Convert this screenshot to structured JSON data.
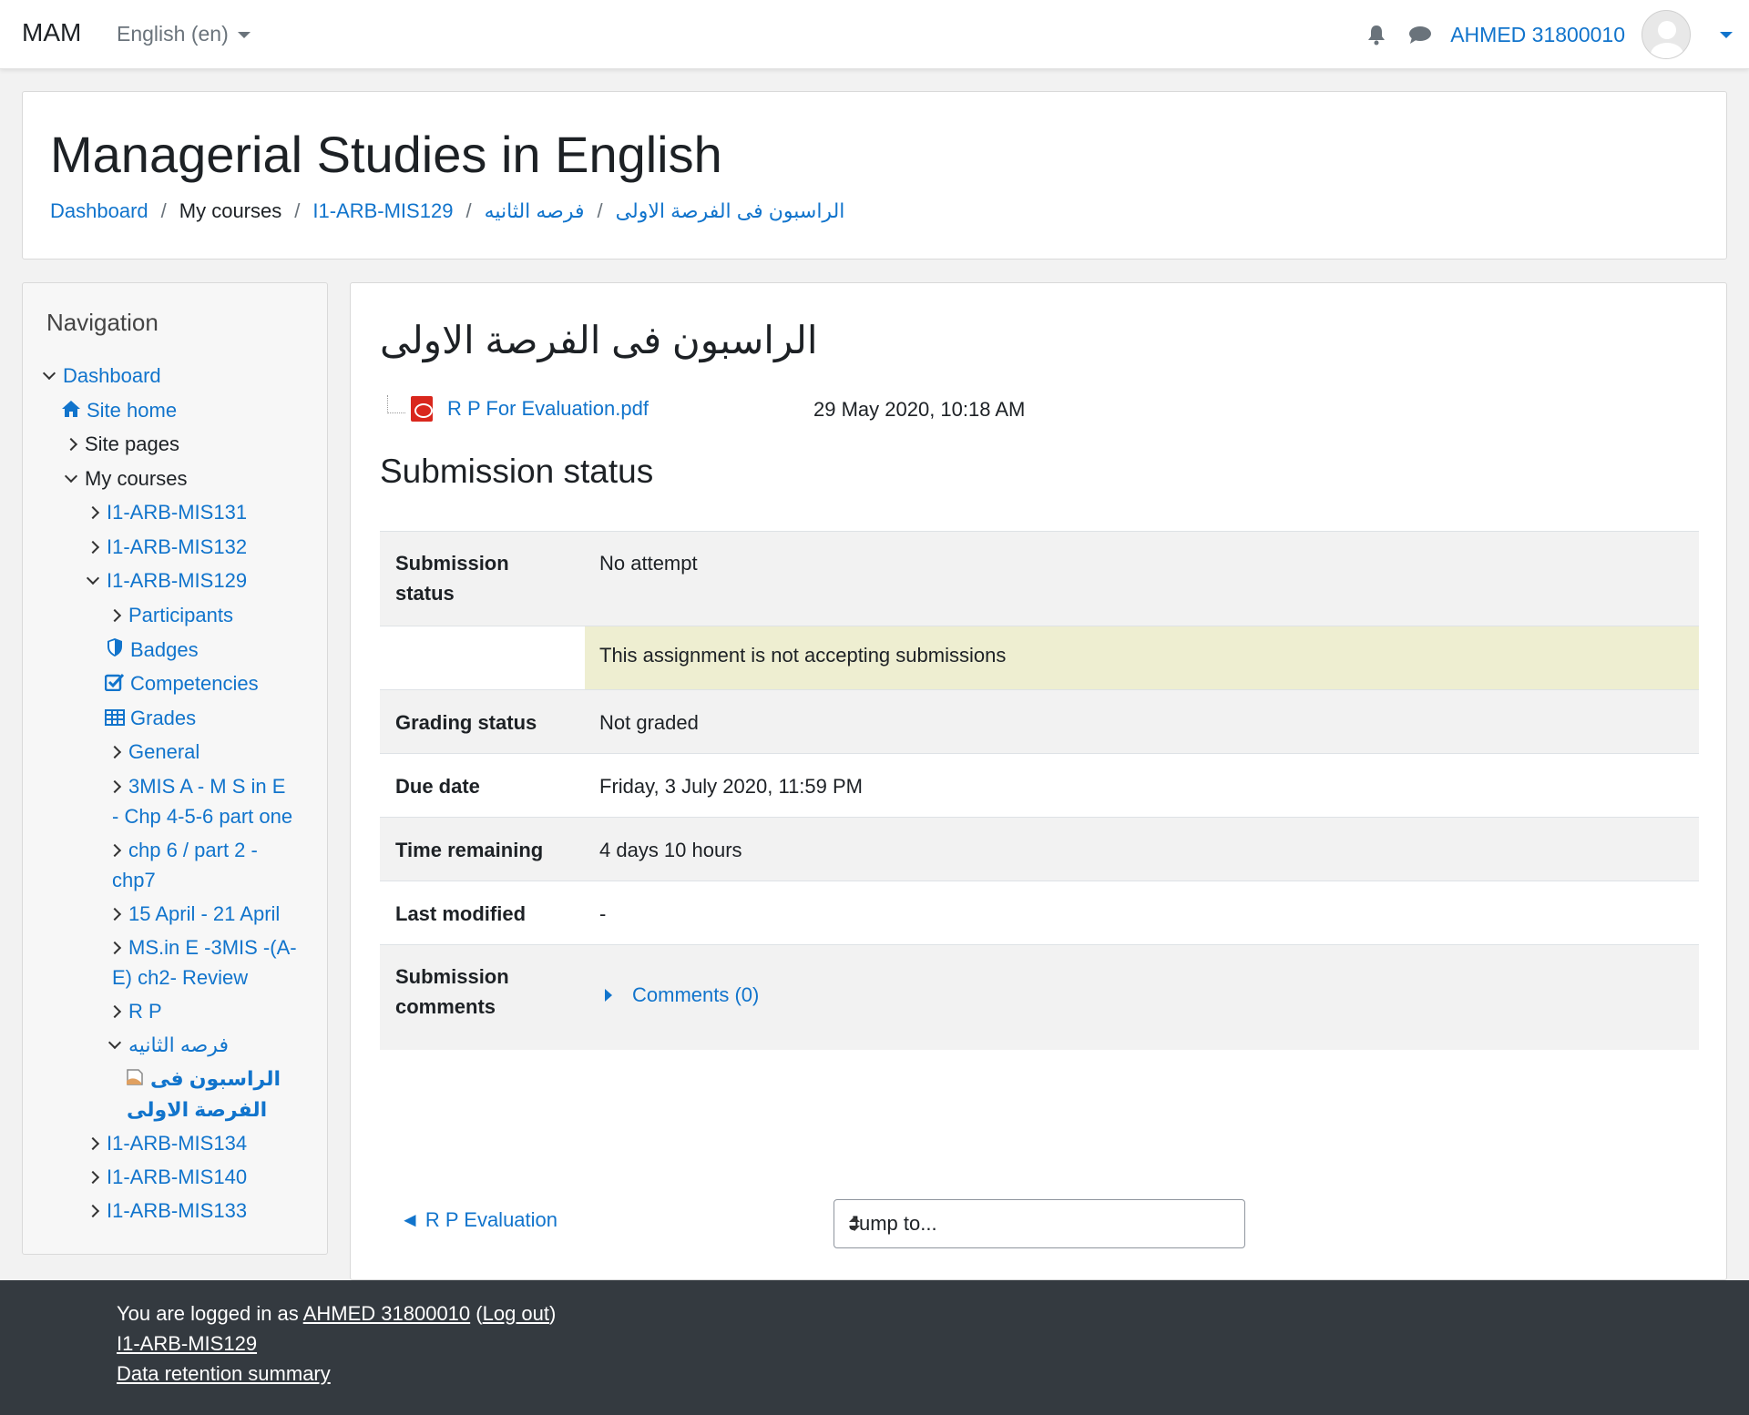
{
  "navbar": {
    "brand": "MAM",
    "language": "English (en)",
    "username": "AHMED 31800010"
  },
  "header": {
    "title": "Managerial Studies in English",
    "breadcrumb": {
      "dashboard": "Dashboard",
      "my_courses": "My courses",
      "course": "I1-ARB-MIS129",
      "section": "فرصه الثانيه",
      "activity": "الراسبون فى الفرصة الاولى"
    }
  },
  "nav": {
    "title": "Navigation",
    "dashboard": "Dashboard",
    "site_home": "Site home",
    "site_pages": "Site pages",
    "my_courses": "My courses",
    "mis131": "I1-ARB-MIS131",
    "mis132": "I1-ARB-MIS132",
    "mis129": "I1-ARB-MIS129",
    "participants": "Participants",
    "badges": "Badges",
    "competencies": "Competencies",
    "grades": "Grades",
    "general": "General",
    "s3mis_l1": "3MIS A - M S in E",
    "s3mis_l2": "- Chp 4-5-6 part one",
    "chp6_l1": "chp 6 / part 2 -",
    "chp6_l2": "chp7",
    "april": "15 April - 21 April",
    "msine_l1": "MS.in E -3MIS -(A-",
    "msine_l2": "E) ch2- Review",
    "rp": "R P",
    "second_chance": "فرصه الثانيه",
    "activity_l1": "الراسبون فى",
    "activity_l2": "الفرصة الاولى",
    "mis134": "I1-ARB-MIS134",
    "mis140": "I1-ARB-MIS140",
    "mis133": "I1-ARB-MIS133"
  },
  "main": {
    "title": "الراسبون فى الفرصة الاولى",
    "file_name": "R P For Evaluation.pdf",
    "file_date": "29 May 2020, 10:18 AM",
    "status_heading": "Submission status",
    "rows": {
      "submission_status_label_1": "Submission",
      "submission_status_label_2": "status",
      "submission_status_value": "No attempt",
      "notice": "This assignment is not accepting submissions",
      "grading_label": "Grading status",
      "grading_value": "Not graded",
      "due_label": "Due date",
      "due_value": "Friday, 3 July 2020, 11:59 PM",
      "remaining_label": "Time remaining",
      "remaining_value": "4 days 10 hours",
      "modified_label": "Last modified",
      "modified_value": "-",
      "comments_label_1": "Submission",
      "comments_label_2": "comments",
      "comments_value": "Comments (0)"
    },
    "prev_link": "◄ R P Evaluation",
    "jump_placeholder": "Jump to..."
  },
  "footer": {
    "logged_prefix": "You are logged in as ",
    "user": "AHMED 31800010",
    "open_paren": " (",
    "logout": "Log out",
    "close_paren": ")",
    "course": "I1-ARB-MIS129",
    "data_retention": "Data retention summary"
  },
  "colors": {
    "link": "#1174cc",
    "footer_bg": "#343a40",
    "notice_bg": "#eeeed1",
    "row_shade": "#f2f2f2"
  }
}
